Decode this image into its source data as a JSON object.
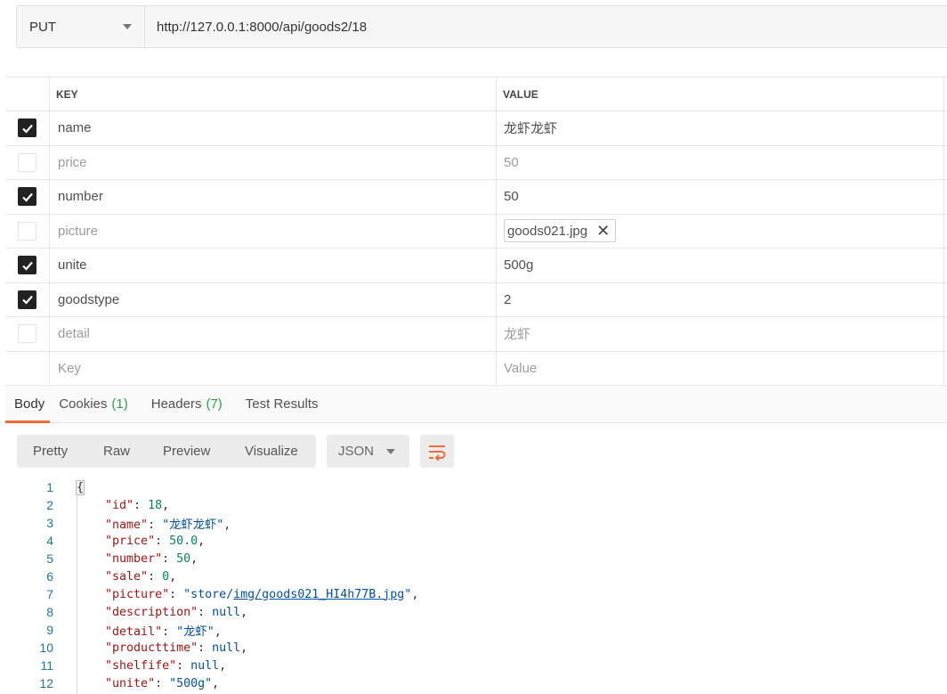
{
  "request": {
    "method": "PUT",
    "url": "http://127.0.0.1:8000/api/goods2/18"
  },
  "params": {
    "headers": {
      "key": "KEY",
      "value": "VALUE"
    },
    "rows": [
      {
        "checked": true,
        "key": "name",
        "value": "龙虾龙虾"
      },
      {
        "checked": false,
        "key": "price",
        "value": "50"
      },
      {
        "checked": true,
        "key": "number",
        "value": "50"
      },
      {
        "checked": false,
        "key": "picture",
        "value": "goods021.jpg",
        "is_file": true
      },
      {
        "checked": true,
        "key": "unite",
        "value": "500g"
      },
      {
        "checked": true,
        "key": "goodstype",
        "value": "2"
      },
      {
        "checked": false,
        "key": "detail",
        "value": "龙虾"
      }
    ],
    "placeholder": {
      "key": "Key",
      "value": "Value"
    }
  },
  "response_tabs": [
    {
      "label": "Body",
      "count": "",
      "active": true
    },
    {
      "label": "Cookies",
      "count": "(1)",
      "active": false
    },
    {
      "label": "Headers",
      "count": "(7)",
      "active": false
    },
    {
      "label": "Test Results",
      "count": "",
      "active": false
    }
  ],
  "view_modes": [
    "Pretty",
    "Raw",
    "Preview",
    "Visualize"
  ],
  "format": "JSON",
  "wrap_icon": "wrap-lines-icon",
  "accent_color": "#f26b3a",
  "code_lines": [
    {
      "n": "1",
      "tokens": [
        [
          "brace",
          "{"
        ]
      ]
    },
    {
      "n": "2",
      "tokens": [
        [
          "p",
          "    "
        ],
        [
          "k",
          "\"id\""
        ],
        [
          "p",
          ": "
        ],
        [
          "n",
          "18"
        ],
        [
          "p",
          ","
        ]
      ]
    },
    {
      "n": "3",
      "tokens": [
        [
          "p",
          "    "
        ],
        [
          "k",
          "\"name\""
        ],
        [
          "p",
          ": "
        ],
        [
          "s",
          "\"龙虾龙虾\""
        ],
        [
          "p",
          ","
        ]
      ]
    },
    {
      "n": "4",
      "tokens": [
        [
          "p",
          "    "
        ],
        [
          "k",
          "\"price\""
        ],
        [
          "p",
          ": "
        ],
        [
          "n",
          "50.0"
        ],
        [
          "p",
          ","
        ]
      ]
    },
    {
      "n": "5",
      "tokens": [
        [
          "p",
          "    "
        ],
        [
          "k",
          "\"number\""
        ],
        [
          "p",
          ": "
        ],
        [
          "n",
          "50"
        ],
        [
          "p",
          ","
        ]
      ]
    },
    {
      "n": "6",
      "tokens": [
        [
          "p",
          "    "
        ],
        [
          "k",
          "\"sale\""
        ],
        [
          "p",
          ": "
        ],
        [
          "n",
          "0"
        ],
        [
          "p",
          ","
        ]
      ]
    },
    {
      "n": "7",
      "tokens": [
        [
          "p",
          "    "
        ],
        [
          "k",
          "\"picture\""
        ],
        [
          "p",
          ": "
        ],
        [
          "s",
          "\"store/"
        ],
        [
          "lnk",
          "img/goods021_HI4h77B.jpg"
        ],
        [
          "s",
          "\""
        ],
        [
          "p",
          ","
        ]
      ]
    },
    {
      "n": "8",
      "tokens": [
        [
          "p",
          "    "
        ],
        [
          "k",
          "\"description\""
        ],
        [
          "p",
          ": "
        ],
        [
          "kw",
          "null"
        ],
        [
          "p",
          ","
        ]
      ]
    },
    {
      "n": "9",
      "tokens": [
        [
          "p",
          "    "
        ],
        [
          "k",
          "\"detail\""
        ],
        [
          "p",
          ": "
        ],
        [
          "s",
          "\"龙虾\""
        ],
        [
          "p",
          ","
        ]
      ]
    },
    {
      "n": "10",
      "tokens": [
        [
          "p",
          "    "
        ],
        [
          "k",
          "\"producttime\""
        ],
        [
          "p",
          ": "
        ],
        [
          "kw",
          "null"
        ],
        [
          "p",
          ","
        ]
      ]
    },
    {
      "n": "11",
      "tokens": [
        [
          "p",
          "    "
        ],
        [
          "k",
          "\"shelfife\""
        ],
        [
          "p",
          ": "
        ],
        [
          "kw",
          "null"
        ],
        [
          "p",
          ","
        ]
      ]
    },
    {
      "n": "12",
      "tokens": [
        [
          "p",
          "    "
        ],
        [
          "k",
          "\"unite\""
        ],
        [
          "p",
          ": "
        ],
        [
          "s",
          "\"500g\""
        ],
        [
          "p",
          ","
        ]
      ]
    }
  ]
}
